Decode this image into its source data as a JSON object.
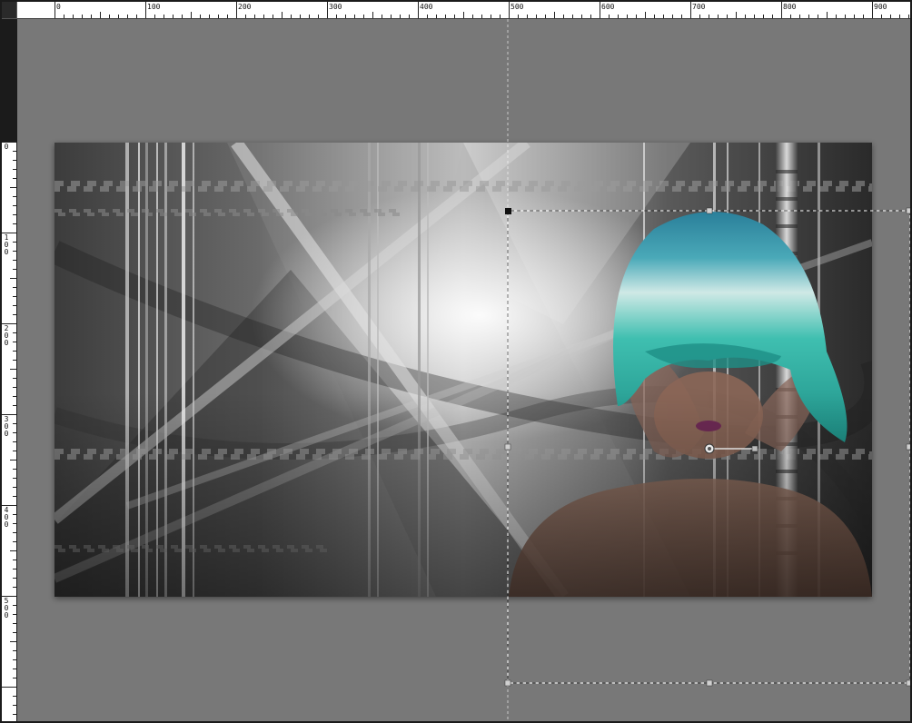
{
  "ruler": {
    "top_labels": [
      "0",
      "100",
      "200",
      "300",
      "400",
      "500",
      "600",
      "700",
      "800",
      "900"
    ],
    "left_labels": [
      "0",
      "100",
      "200",
      "300",
      "400",
      "500"
    ]
  },
  "colors": {
    "workspace": "#787878",
    "frame": "#1b1b1b",
    "ruler_bg": "#ffffff",
    "hair": "#3fbfb0",
    "hair_dark": "#2a7f9a"
  },
  "icons": {
    "rotation_handle": "circle-handle-icon",
    "corner_handle": "square-handle-icon"
  }
}
